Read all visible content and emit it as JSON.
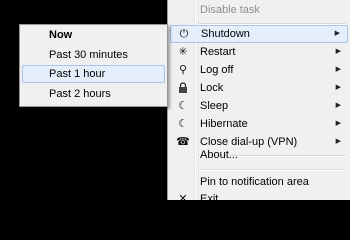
{
  "main_menu": {
    "disable_task": "Disable task",
    "items": [
      {
        "label": "Shutdown",
        "icon": "⏻",
        "icon_name": "power-icon",
        "arrow": "▶"
      },
      {
        "label": "Restart",
        "icon": "✳",
        "icon_name": "restart-icon",
        "arrow": "▶"
      },
      {
        "label": "Log off",
        "icon": "⚲",
        "icon_name": "key-icon",
        "arrow": "▶"
      },
      {
        "label": "Lock",
        "icon": "🔒",
        "icon_name": "lock-icon",
        "arrow": "▶"
      },
      {
        "label": "Sleep",
        "icon": "☾",
        "icon_name": "moon-icon",
        "arrow": "▶"
      },
      {
        "label": "Hibernate",
        "icon": "☾",
        "icon_name": "moon-icon",
        "arrow": "▶"
      },
      {
        "label": "Close dial-up (VPN)",
        "icon": "☎",
        "icon_name": "phone-icon",
        "arrow": "▶"
      }
    ],
    "about": "About...",
    "pin": "Pin to notification area",
    "exit": "Exit",
    "exit_icon": "✕"
  },
  "submenu": {
    "items": [
      "Now",
      "Past 30 minutes",
      "Past 1 hour",
      "Past 2 hours"
    ]
  },
  "colors": {
    "menu_bg": "#f0f0f0",
    "highlight_bg": "#e5eefb",
    "highlight_border": "#a8c4ec",
    "disabled_text": "#8d8d8d"
  }
}
